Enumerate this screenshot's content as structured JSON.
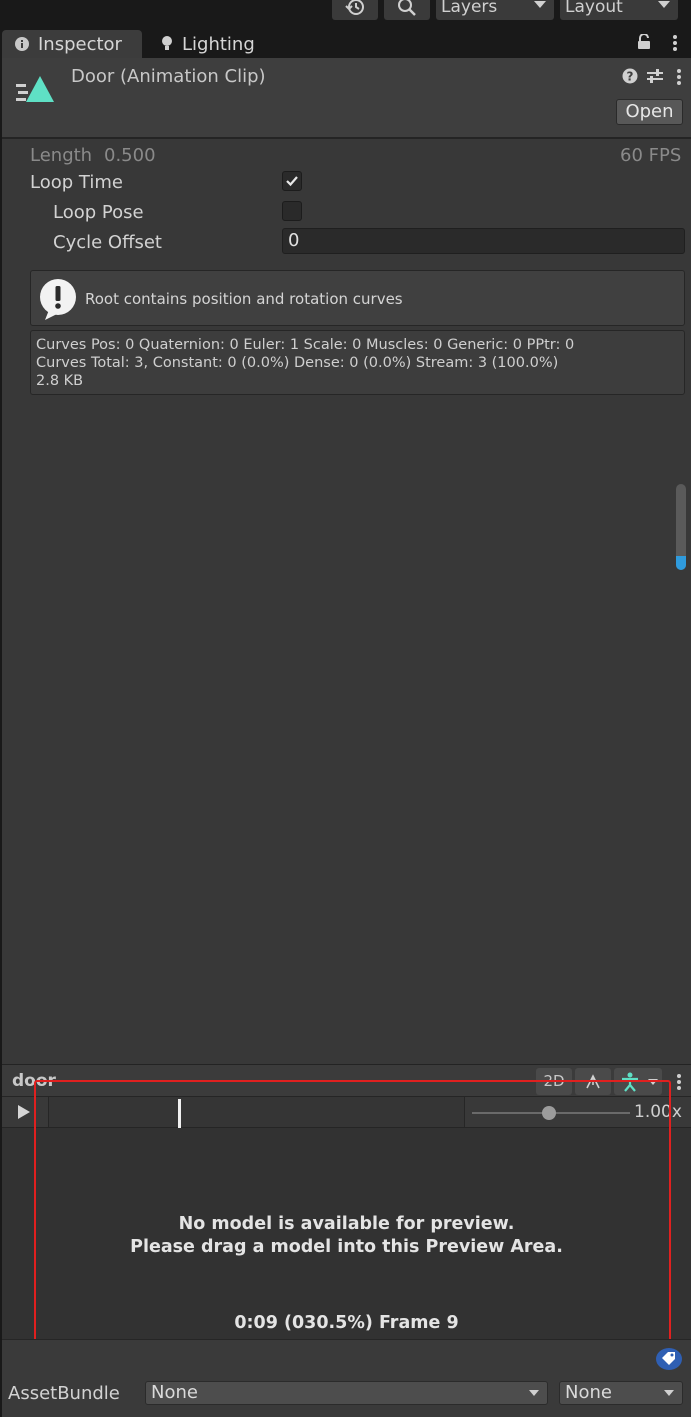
{
  "toolbar": {
    "layers_label": "Layers",
    "layout_label": "Layout"
  },
  "tabs": [
    {
      "label": "Inspector",
      "icon": "info-icon",
      "active": true
    },
    {
      "label": "Lighting",
      "icon": "bulb-icon",
      "active": false
    }
  ],
  "header": {
    "title": "Door (Animation Clip)",
    "open_label": "Open",
    "icon_color": "#5fe0c5"
  },
  "clip": {
    "length_label": "Length",
    "length_value": "0.500",
    "fps": "60 FPS",
    "loop_time_label": "Loop Time",
    "loop_time_checked": true,
    "loop_pose_label": "Loop Pose",
    "loop_pose_checked": false,
    "cycle_offset_label": "Cycle Offset",
    "cycle_offset_value": "0"
  },
  "warning": {
    "message": "Root contains position and rotation curves"
  },
  "stats": {
    "line1": "Curves Pos: 0 Quaternion: 0 Euler: 1 Scale: 0 Muscles: 0 Generic: 0 PPtr: 0",
    "line2": "Curves Total: 3, Constant: 0 (0.0%) Dense: 0 (0.0%) Stream: 3 (100.0%)",
    "line3": "2.8 KB"
  },
  "preview": {
    "name": "door",
    "mode_2d": "2D",
    "speed": "1.00x",
    "speed_fraction": 0.49,
    "playhead_fraction": 0.31,
    "message_line1": "No model is available for preview.",
    "message_line2": "Please drag a model into this Preview Area.",
    "time_readout": "0:09 (030.5%) Frame 9"
  },
  "footer": {
    "assetbundle_label": "AssetBundle",
    "bundle_value": "None",
    "variant_value": "None"
  },
  "colors": {
    "accent": "#5fe0c5",
    "highlight_border": "#e0201f",
    "scroll_accent": "#2f9bdd",
    "tag_badge": "#2f5fb3"
  }
}
